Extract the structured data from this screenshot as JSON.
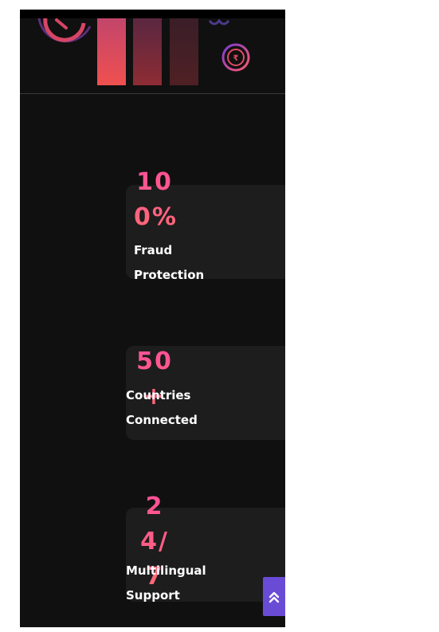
{
  "hero": {
    "icons": [
      "donut-chart-icon",
      "rupee-coin-icon",
      "settings-gear-icon"
    ],
    "bars": [
      "bar-chart-bar-1",
      "bar-chart-bar-2",
      "bar-chart-bar-3"
    ]
  },
  "stats": [
    {
      "value": "100%",
      "label": "Fraud Protection"
    },
    {
      "value": "50+",
      "label": "Countries Connected"
    },
    {
      "value": "24/7",
      "label": "Multilingual Support"
    }
  ],
  "colors": {
    "accent_gradient_start": "#ff4f9a",
    "accent_gradient_end": "#ff6b72",
    "scroll_button": "#6a4bd6",
    "background": "#101010",
    "card": "#1d1d1d"
  },
  "scroll_top": {
    "icon": "double-chevron-up-icon"
  }
}
